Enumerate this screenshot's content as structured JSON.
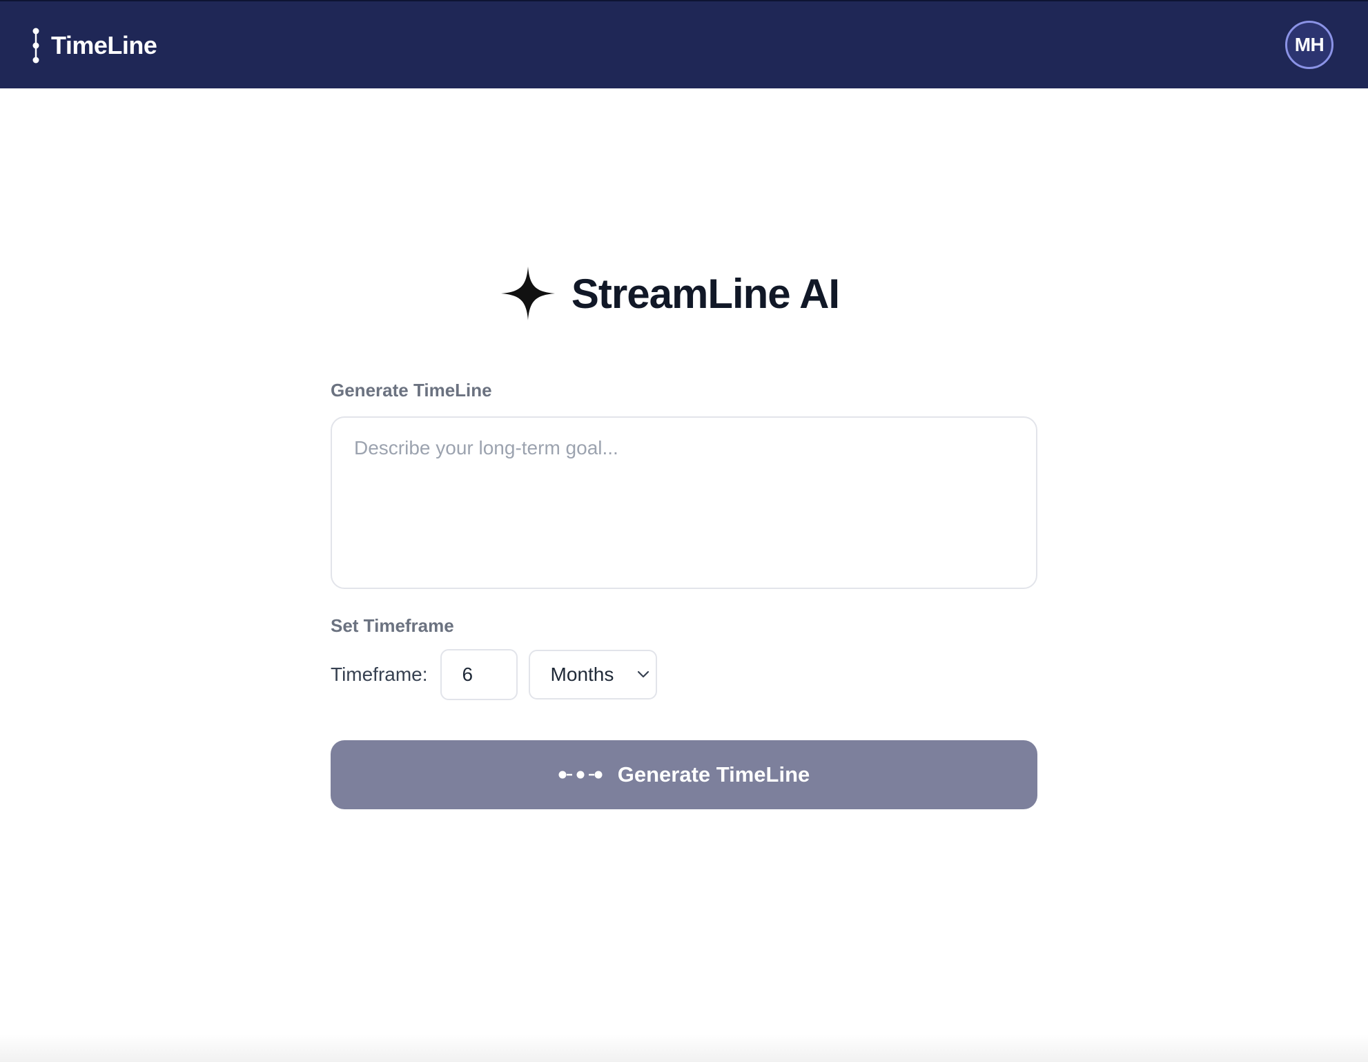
{
  "header": {
    "app_name": "TimeLine",
    "brand_icon": "timeline-vertical-dots-icon",
    "avatar_initials": "MH"
  },
  "hero": {
    "icon": "sparkle-icon",
    "title": "StreamLine AI"
  },
  "form": {
    "goal_label": "Generate TimeLine",
    "goal_placeholder": "Describe your long-term goal...",
    "goal_value": "",
    "timeframe_section_label": "Set Timeframe",
    "timeframe_label": "Timeframe:",
    "timeframe_value": "6",
    "timeframe_unit": "Months",
    "generate_button": {
      "icon": "timeline-dots-icon",
      "label": "Generate TimeLine"
    }
  },
  "colors": {
    "navbar": "#1f2756",
    "avatar_border": "#8b93e6",
    "button": "#7d809c",
    "title_text": "#111827",
    "section_label": "#6b7280"
  }
}
